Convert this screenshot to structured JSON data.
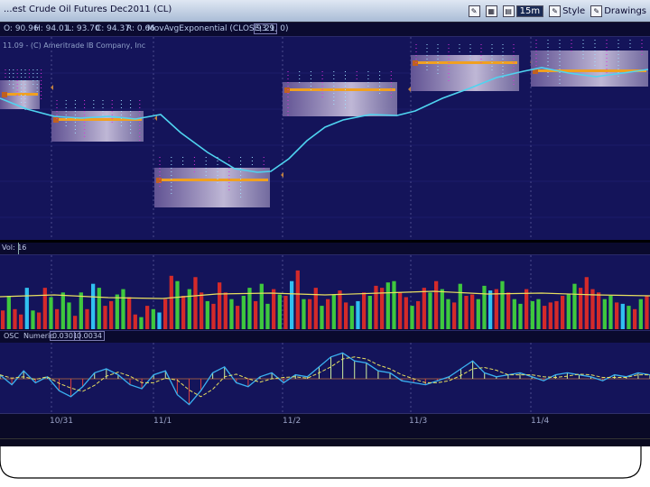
{
  "window": {
    "title": "...est Crude Oil Futures Dec2011 (CL)",
    "toolbar": [
      {
        "icon": "pencil-icon",
        "label": ""
      },
      {
        "icon": "grid-icon",
        "label": ""
      },
      {
        "icon": "timeframe-icon",
        "label": "15m"
      },
      {
        "icon": "pencil-icon",
        "label": "Style"
      },
      {
        "icon": "pencil-icon",
        "label": "Drawings"
      }
    ]
  },
  "ohlc_bar": {
    "open": "O: 90.96",
    "high": "H: 94.01",
    "low": "L: 93.70",
    "close": "C: 94.37",
    "range": "R: 0.66",
    "study": "MovAvgExponential (CLOSE, 21, 0)",
    "value": "93.9"
  },
  "price_panel": {
    "label": "11.09 - (C) Ameritrade IB Company, Inc"
  },
  "volume_panel": {
    "label": "Vol: 16"
  },
  "osc_panel": {
    "name": "OSC",
    "params": "Numeric",
    "value1": "0.0301",
    "value2": "0.0034"
  },
  "x_axis": {
    "labels": [
      "10/31",
      "11/1",
      "11/2",
      "11/3",
      "11/4"
    ]
  },
  "colors": {
    "background": "#14145a",
    "ema_line": "#4fd4f0",
    "vol_up": "#3ec83e",
    "vol_down": "#d42a2a",
    "vol_avg": "#e8e060",
    "osc_line": "#3ab0f0",
    "osc_signal": "#e8e060",
    "profile_point": "#f0a020"
  },
  "chart_data": {
    "type": "line",
    "series": [
      {
        "values": [
          93.5,
          93.2,
          92.6,
          91.6,
          91.2,
          92.2,
          93.4,
          93.6,
          93.9,
          93.9
        ]
      }
    ],
    "volume": [
      0.28,
      0.5,
      0.3,
      0.22,
      0.62,
      0.28,
      0.25,
      0.62,
      0.48,
      0.3,
      0.55,
      0.4,
      0.2,
      0.55,
      0.3,
      0.68,
      0.62,
      0.35,
      0.42,
      0.52,
      0.6,
      0.48,
      0.22,
      0.18,
      0.35,
      0.3,
      0.25,
      0.45,
      0.8,
      0.72,
      0.5,
      0.6,
      0.78,
      0.55,
      0.42,
      0.38,
      0.7,
      0.55,
      0.45,
      0.35,
      0.5,
      0.62,
      0.42,
      0.68,
      0.38,
      0.6,
      0.52,
      0.5,
      0.72,
      0.88,
      0.45,
      0.45,
      0.62,
      0.35,
      0.45,
      0.52,
      0.58,
      0.4,
      0.35,
      0.42,
      0.55,
      0.5,
      0.65,
      0.62,
      0.7,
      0.72,
      0.55,
      0.48,
      0.35,
      0.42,
      0.62,
      0.55,
      0.72,
      0.6,
      0.45,
      0.4,
      0.68,
      0.5,
      0.52,
      0.45,
      0.65,
      0.58,
      0.6,
      0.72,
      0.55,
      0.45,
      0.38,
      0.6,
      0.42,
      0.45,
      0.35,
      0.4,
      0.42,
      0.5,
      0.52,
      0.68,
      0.62,
      0.78,
      0.6,
      0.55,
      0.45,
      0.5,
      0.4,
      0.38,
      0.35,
      0.3,
      0.45,
      0.5
    ],
    "oscillator": [
      0.2,
      -0.3,
      0.4,
      -0.2,
      0.1,
      -0.6,
      -0.9,
      -0.4,
      0.3,
      0.5,
      0.2,
      -0.3,
      -0.5,
      0.2,
      0.4,
      -0.8,
      -1.3,
      -0.6,
      0.3,
      0.6,
      -0.2,
      -0.4,
      0.1,
      0.3,
      -0.2,
      0.2,
      0.1,
      0.6,
      1.1,
      1.3,
      0.9,
      0.8,
      0.4,
      0.3,
      -0.1,
      -0.2,
      -0.3,
      -0.1,
      0.1,
      0.5,
      0.9,
      0.3,
      0.1,
      0.2,
      0.3,
      0.1,
      -0.1,
      0.2,
      0.3,
      0.2,
      0.1,
      -0.1,
      0.2,
      0.1,
      0.3,
      0.2
    ]
  }
}
